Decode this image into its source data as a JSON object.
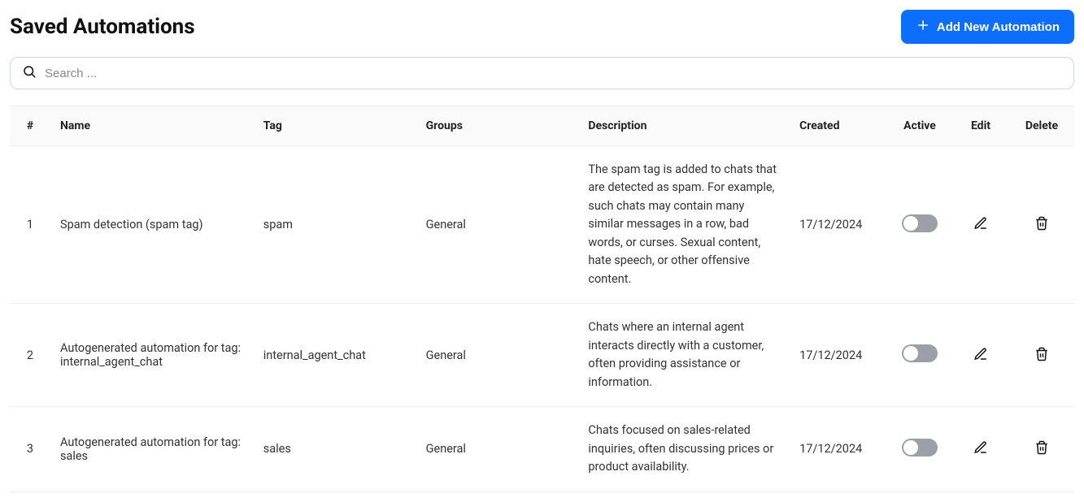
{
  "header": {
    "title": "Saved Automations",
    "add_button": "Add New Automation"
  },
  "search": {
    "placeholder": "Search ..."
  },
  "table": {
    "columns": {
      "idx": "#",
      "name": "Name",
      "tag": "Tag",
      "groups": "Groups",
      "description": "Description",
      "created": "Created",
      "active": "Active",
      "edit": "Edit",
      "delete": "Delete"
    },
    "rows": [
      {
        "idx": "1",
        "name": "Spam detection (spam tag)",
        "tag": "spam",
        "groups": "General",
        "description": "The spam tag is added to chats that are detected as spam. For example, such chats may contain many similar messages in a row, bad words, or curses. Sexual content, hate speech, or other offensive content.",
        "created": "17/12/2024",
        "active": false
      },
      {
        "idx": "2",
        "name": "Autogenerated automation for tag: internal_agent_chat",
        "tag": "internal_agent_chat",
        "groups": "General",
        "description": "Chats where an internal agent interacts directly with a customer, often providing assistance or information.",
        "created": "17/12/2024",
        "active": false
      },
      {
        "idx": "3",
        "name": "Autogenerated automation for tag: sales",
        "tag": "sales",
        "groups": "General",
        "description": "Chats focused on sales-related inquiries, often discussing prices or product availability.",
        "created": "17/12/2024",
        "active": false
      }
    ]
  }
}
